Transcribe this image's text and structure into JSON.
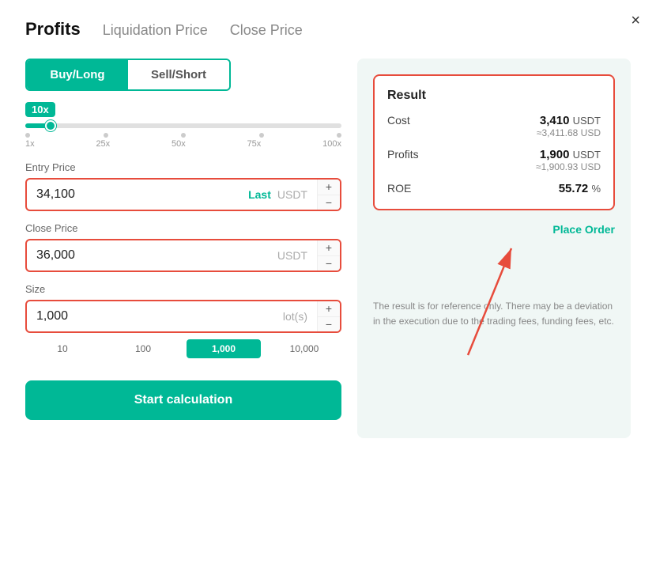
{
  "modal": {
    "close_icon": "×"
  },
  "tabs": [
    {
      "label": "Profits",
      "active": true
    },
    {
      "label": "Liquidation Price",
      "active": false
    },
    {
      "label": "Close Price",
      "active": false
    }
  ],
  "toggle": {
    "buy_label": "Buy/Long",
    "sell_label": "Sell/Short"
  },
  "leverage": {
    "value": "10x",
    "marks": [
      "1x",
      "25x",
      "50x",
      "75x",
      "100x"
    ]
  },
  "entry_price": {
    "label": "Entry Price",
    "value": "34,100",
    "unit_highlight": "Last",
    "unit": "USDT"
  },
  "close_price": {
    "label": "Close Price",
    "value": "36,000",
    "unit": "USDT"
  },
  "size": {
    "label": "Size",
    "value": "1,000",
    "unit": "lot(s)",
    "options": [
      "10",
      "100",
      "1,000",
      "10,000"
    ]
  },
  "calc_button": "Start calculation",
  "result": {
    "title": "Result",
    "cost_label": "Cost",
    "cost_main": "3,410",
    "cost_unit": "USDT",
    "cost_sub": "≈3,411.68 USD",
    "profits_label": "Profits",
    "profits_main": "1,900",
    "profits_unit": "USDT",
    "profits_sub": "≈1,900.93 USD",
    "roe_label": "ROE",
    "roe_value": "55.72",
    "roe_unit": "%"
  },
  "place_order": "Place Order",
  "disclaimer": "The result is for reference only. There may be a deviation in the execution due to the trading fees, funding fees, etc."
}
